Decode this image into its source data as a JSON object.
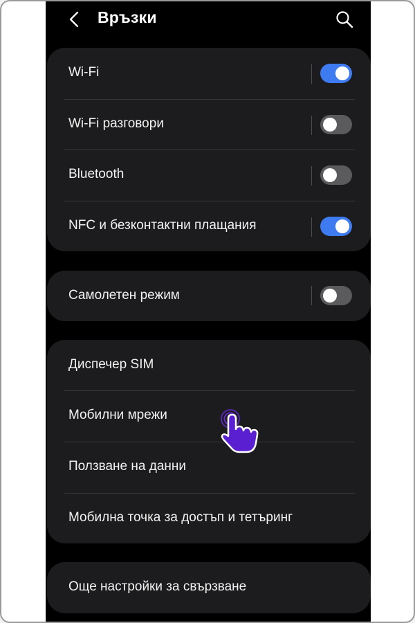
{
  "header": {
    "title": "Връзки",
    "back_icon": "chevron-left-icon",
    "search_icon": "search-icon"
  },
  "colors": {
    "toggle_on": "#3e7bf0",
    "toggle_off": "#5b5b5e",
    "card_bg": "#1c1c1e",
    "hand_pointer": "#6a2bd9"
  },
  "group1": {
    "wifi": {
      "label": "Wi-Fi",
      "enabled": true
    },
    "wifi_calling": {
      "label": "Wi-Fi разговори",
      "enabled": false
    },
    "bluetooth": {
      "label": "Bluetooth",
      "enabled": false
    },
    "nfc": {
      "label": "NFC и безконтактни плащания",
      "enabled": true
    }
  },
  "group2": {
    "airplane": {
      "label": "Самолетен режим",
      "enabled": false
    }
  },
  "group3": {
    "sim_manager": {
      "label": "Диспечер SIM"
    },
    "mobile_networks": {
      "label": "Мобилни мрежи"
    },
    "data_usage": {
      "label": "Ползване на данни"
    },
    "hotspot": {
      "label": "Мобилна точка за достъп и тетъринг"
    }
  },
  "group4": {
    "more_settings": {
      "label": "Още настройки за свързване"
    }
  },
  "tap_indicator": {
    "icon": "tap-hand-icon"
  }
}
